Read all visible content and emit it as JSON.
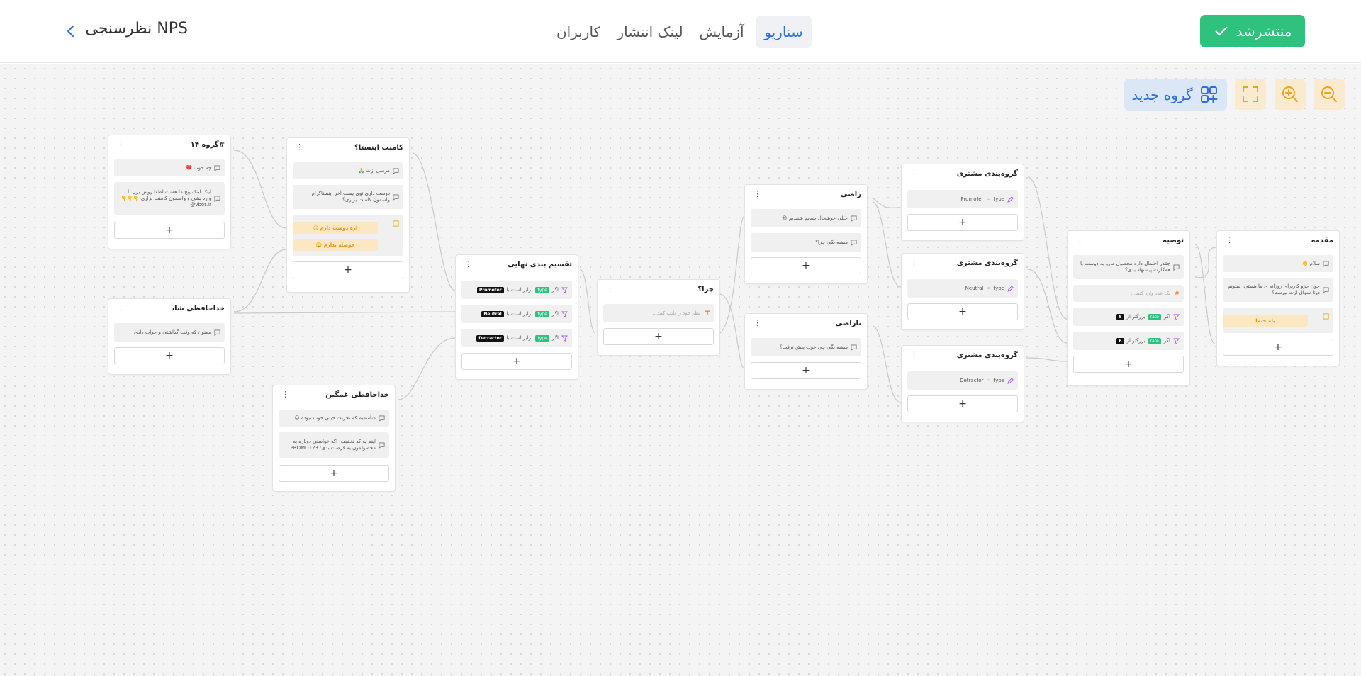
{
  "header": {
    "publish_label": "منتشرشد",
    "tabs": [
      {
        "label": "سناریو",
        "active": true
      },
      {
        "label": "آزمایش",
        "active": false
      },
      {
        "label": "لینک انتشار",
        "active": false
      },
      {
        "label": "کاربران",
        "active": false
      }
    ],
    "survey_title": "نظرسنجی NPS"
  },
  "toolbar": {
    "new_group_label": "گروه جدید",
    "tools": [
      "zoom-out-icon",
      "zoom-in-icon",
      "fullscreen-icon"
    ]
  },
  "colors": {
    "publish": "#2ec27e",
    "accent": "#2f6fd6",
    "tool_bg": "#faebd0",
    "choice_text": "#e2961a",
    "filter": "#a855f7",
    "wire": "#c9c9c9"
  },
  "nodes": {
    "intro": {
      "title": "مقدمه",
      "msg1": "سلام 👋",
      "msg2": "چون جزو کاربرای روزانه ی ما هستی، میتونم دوتا سوال ازت بپرسم؟",
      "choice": "بله حتما"
    },
    "recommend": {
      "title": "توصیه",
      "q": "چقدر احتمال داره محصول مارو به دوست یا همکارت پیشنهاد بدی؟",
      "placeholder": "یک عدد وارد کنید...",
      "c1_pre": "اگر",
      "c1_tag": "rate",
      "c1_mid": "بزرگتر از",
      "c1_val": "8",
      "c2_pre": "اگر",
      "c2_tag": "rate",
      "c2_mid": "بزرگتر از",
      "c2_val": "6"
    },
    "seg_promoter": {
      "title": "گروه‌بندی مشتری",
      "field": "type",
      "value": "Promoter"
    },
    "seg_neutral": {
      "title": "گروه‌بندی مشتری",
      "field": "type",
      "value": "Neutral"
    },
    "seg_detractor": {
      "title": "گروه‌بندی مشتری",
      "field": "type",
      "value": "Detractor"
    },
    "happy": {
      "title": "راضی",
      "msg1": "خیلی خوشحال شدیم شنیدیم 😍",
      "msg2": "میشه بگی چرا؟"
    },
    "unhappy": {
      "title": "ناراضی",
      "msg1": "میشه بگی چی خوب پیش نرفت؟"
    },
    "why": {
      "title": "چرا؟",
      "placeholder": "نظر خود را تایپ کنید..."
    },
    "final": {
      "title": "تقسیم بندی نهایی",
      "rows": [
        {
          "pre": "اگر",
          "tag": "type",
          "mid": "برابر است با",
          "val": "Promoter"
        },
        {
          "pre": "اگر",
          "tag": "type",
          "mid": "برابر است با",
          "val": "Neutral"
        },
        {
          "pre": "اگر",
          "tag": "type",
          "mid": "برابر است با",
          "val": "Detractor"
        }
      ]
    },
    "insta": {
      "title": "کامنت اینستا؟",
      "msg1": "مرسی ازت 🙏",
      "msg2": "دوست داری توی پست آخر اینستاگرام واسمون کامنت بزاری؟",
      "choice1": "آره دوست دارم 😍",
      "choice2": "حوصله ندارم 🙄"
    },
    "group14": {
      "title": "#گروه ۱۴",
      "msg1": "چه خوب ❤️",
      "msg2": "اینک لینک پیج ما هست لطفا روش بزن تا وارد بشی و واسمون کامنت بزاری 👇👇👇 vbot.ir@"
    },
    "bye_happy": {
      "title": "خداحافظی شاد",
      "msg1": "ممنون که وقت گذاشتی و جواب دادی!"
    },
    "bye_sad": {
      "title": "خداحافظی غمگین",
      "msg1": "متأسفیم که تجربت خیلی خوب نبوده 😕",
      "msg2": "اینم یه کد تخفیف، اگه خواستی دوباره به محصولمون یه فرصت بدی: PROMO123"
    }
  }
}
